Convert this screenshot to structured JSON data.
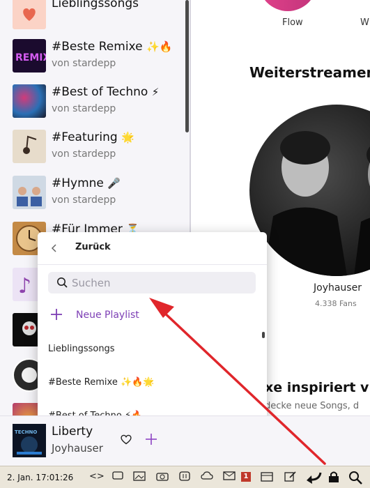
{
  "sidebar": {
    "items": [
      {
        "title": "Lieblingssongs",
        "owner": "",
        "thumb": "heart",
        "emoji": ""
      },
      {
        "title": "#Beste Remixe",
        "owner": "von stardepp",
        "thumb": "remix",
        "emoji": "✨🔥"
      },
      {
        "title": "#Best of Techno",
        "owner": "von stardepp",
        "thumb": "techno",
        "emoji": "⚡"
      },
      {
        "title": "#Featuring",
        "owner": "von stardepp",
        "thumb": "featuring",
        "emoji": "🌟"
      },
      {
        "title": "#Hymne",
        "owner": "von stardepp",
        "thumb": "hymne",
        "emoji": "🎤"
      },
      {
        "title": "#Für Immer",
        "owner": "",
        "thumb": "clock",
        "emoji": "⏳"
      }
    ]
  },
  "right": {
    "flow_label": "Flow",
    "w_label": "W",
    "section_title": "Weiterstreamen",
    "artist_name": "Joyhauser",
    "artist_fans": "4.338 Fans",
    "section_title2": "xe inspiriert v",
    "section_sub": "decke neue Songs, d"
  },
  "popup": {
    "back_label": "Zurück",
    "search_placeholder": "Suchen",
    "new_playlist_label": "Neue Playlist",
    "items": [
      {
        "label": "Lieblingssongs"
      },
      {
        "label": "#Beste Remixe ✨🔥🌟"
      },
      {
        "label": "#Best of Techno ⚡🔥"
      }
    ]
  },
  "player": {
    "title": "Liberty",
    "artist": "Joyhauser"
  },
  "taskbar": {
    "clock": "2. Jan. 17:01:26",
    "mail_badge": "1"
  },
  "colors": {
    "accent": "#7d3fb5",
    "arrow": "#e0262b",
    "heart": "#e8674f"
  }
}
